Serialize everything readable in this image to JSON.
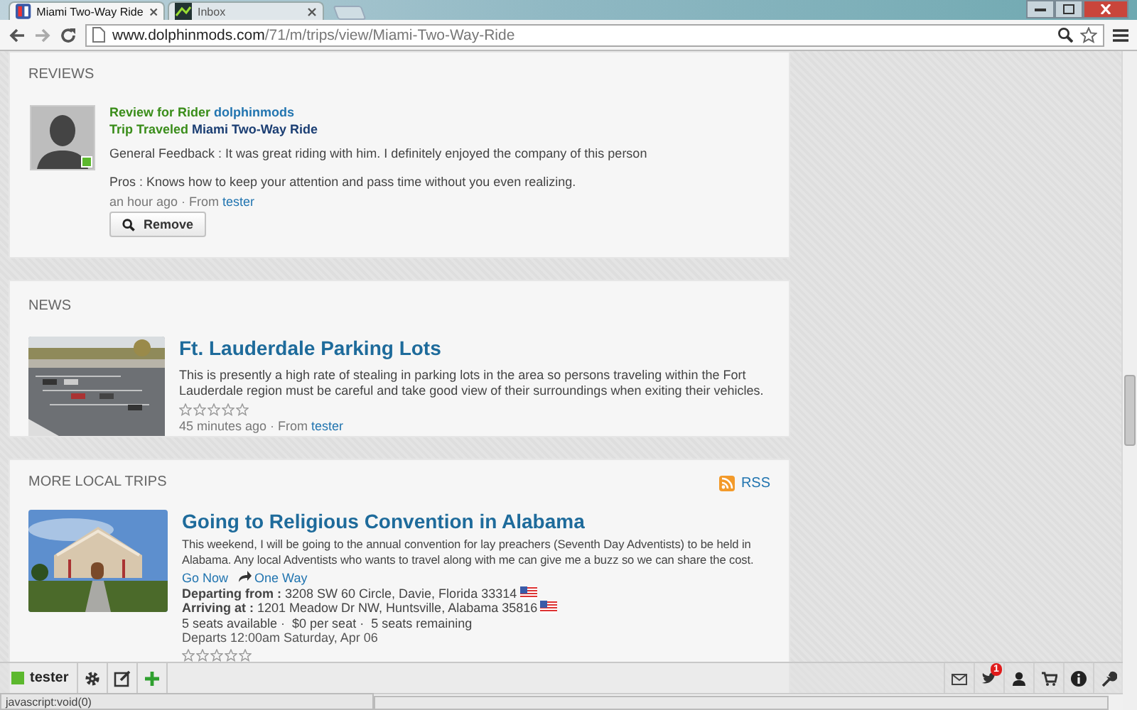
{
  "browser": {
    "tabs": [
      {
        "title": "Miami Two-Way Ride",
        "selected": true
      },
      {
        "title": "Inbox",
        "selected": false
      }
    ],
    "address": {
      "host": "www.dolphinmods.com",
      "path": "/71/m/trips/view/Miami-Two-Way-Ride"
    }
  },
  "reviews": {
    "heading": "REVIEWS",
    "items": [
      {
        "rider_label": "Review for Rider",
        "rider": "dolphinmods",
        "trip_label": "Trip Traveled",
        "trip": "Miami Two-Way Ride",
        "online": true,
        "feedback": "General Feedback : It was great riding with him. I definitely enjoyed the company of this person",
        "pros": "Pros : Knows how to keep your attention and pass time without you even realizing.",
        "meta": "an hour ago · From",
        "from": "tester",
        "button": "Remove"
      }
    ]
  },
  "news": {
    "heading": "NEWS",
    "items": [
      {
        "kind": "picture",
        "title": "Ft. Lauderdale Parking Lots",
        "text": "This is presently a high rate of stealing in parking lots in the area so persons traveling within the Fort Lauderdale region must be careful and take good view of their surroundings when exiting their vehicles.",
        "stars": 0,
        "meta": "45 minutes ago · From",
        "from": "tester"
      }
    ]
  },
  "trips": {
    "heading": "MORE LOCAL TRIPS",
    "rss": "RSS",
    "items": [
      {
        "kind": "picture",
        "title": "Going to Religious Convention in Alabama",
        "text": "This weekend, I will be going to the annual convention for lay preachers (Seventh Day Adventists) to be held in Alabama. Any local Adventists who wants to travel along with me can give me a buzz so we can share the cost.",
        "go_now": "Go Now",
        "way": "One Way",
        "departing_label": "Departing from :",
        "departing": "3208 SW 60 Circle, Davie, Florida 33314",
        "arriving_label": "Arriving at :",
        "arriving": "1201 Meadow Dr NW, Huntsville, Alabama 35816",
        "seats": "5 seats available ·  $0 per seat ·  5 seats remaining",
        "departs": "Departs 12:00am Saturday, Apr 06",
        "stars": 0
      }
    ]
  },
  "toolbar": {
    "user": "tester",
    "online": true,
    "notifications": "1"
  },
  "status_bar": "javascript:void(0)"
}
